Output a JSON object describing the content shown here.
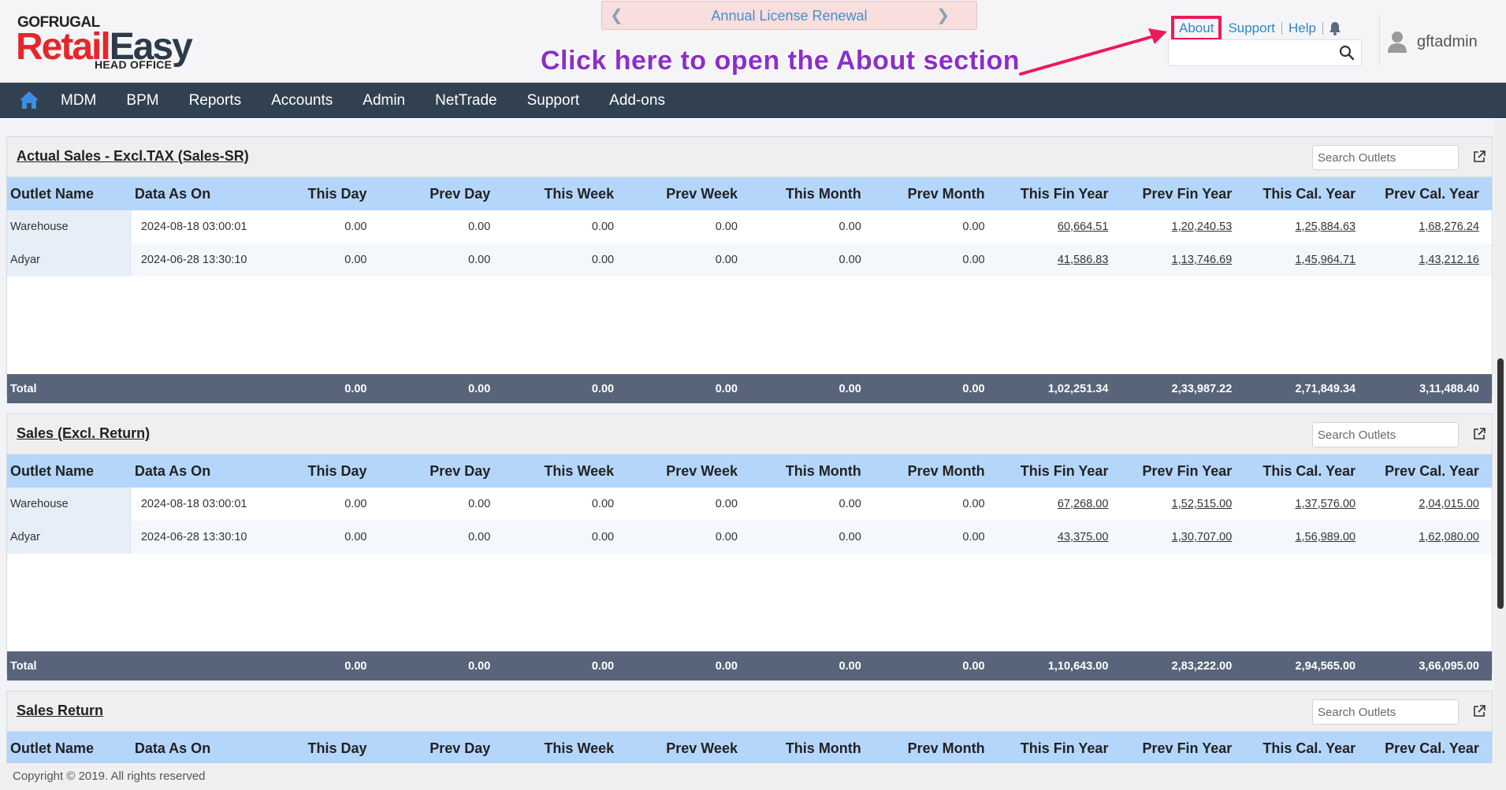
{
  "brand": {
    "top": "GOFRUGAL",
    "main_red": "Retail",
    "main_dark": "Easy",
    "sub": "HEAD OFFICE"
  },
  "renewal": {
    "label": "Annual License Renewal"
  },
  "annotation": {
    "text": "Click here to open the About section"
  },
  "toplinks": {
    "about": "About",
    "support": "Support",
    "help": "Help"
  },
  "search": {
    "placeholder": "",
    "value": ""
  },
  "user": {
    "name": "gftadmin"
  },
  "nav": {
    "items": [
      "MDM",
      "BPM",
      "Reports",
      "Accounts",
      "Admin",
      "NetTrade",
      "Support",
      "Add-ons"
    ]
  },
  "columns": [
    "Outlet Name",
    "Data As On",
    "This Day",
    "Prev Day",
    "This Week",
    "Prev Week",
    "This Month",
    "Prev Month",
    "This Fin Year",
    "Prev Fin Year",
    "This Cal. Year",
    "Prev Cal. Year"
  ],
  "outlet_search_placeholder": "Search Outlets",
  "panels": [
    {
      "title": "Actual Sales - Excl.TAX (Sales-SR)",
      "rows": [
        [
          "Warehouse",
          "2024-08-18 03:00:01",
          "0.00",
          "0.00",
          "0.00",
          "0.00",
          "0.00",
          "0.00",
          "60,664.51",
          "1,20,240.53",
          "1,25,884.63",
          "1,68,276.24"
        ],
        [
          "Adyar",
          "2024-06-28 13:30:10",
          "0.00",
          "0.00",
          "0.00",
          "0.00",
          "0.00",
          "0.00",
          "41,586.83",
          "1,13,746.69",
          "1,45,964.71",
          "1,43,212.16"
        ]
      ],
      "total": [
        "Total",
        "",
        "0.00",
        "0.00",
        "0.00",
        "0.00",
        "0.00",
        "0.00",
        "1,02,251.34",
        "2,33,987.22",
        "2,71,849.34",
        "3,11,488.40"
      ]
    },
    {
      "title": "Sales (Excl. Return)",
      "rows": [
        [
          "Warehouse",
          "2024-08-18 03:00:01",
          "0.00",
          "0.00",
          "0.00",
          "0.00",
          "0.00",
          "0.00",
          "67,268.00",
          "1,52,515.00",
          "1,37,576.00",
          "2,04,015.00"
        ],
        [
          "Adyar",
          "2024-06-28 13:30:10",
          "0.00",
          "0.00",
          "0.00",
          "0.00",
          "0.00",
          "0.00",
          "43,375.00",
          "1,30,707.00",
          "1,56,989.00",
          "1,62,080.00"
        ]
      ],
      "total": [
        "Total",
        "",
        "0.00",
        "0.00",
        "0.00",
        "0.00",
        "0.00",
        "0.00",
        "1,10,643.00",
        "2,83,222.00",
        "2,94,565.00",
        "3,66,095.00"
      ]
    },
    {
      "title": "Sales Return",
      "rows": [],
      "total": []
    }
  ],
  "footer": {
    "text": "Copyright © 2019. All rights reserved"
  },
  "colors": {
    "nav_bg": "#324152",
    "header_row": "#b5d6fb",
    "total_row": "#58647a",
    "annotation": "#8b2fc9",
    "highlight": "#ec1a5b",
    "link": "#2e86c9"
  },
  "icons": [
    "home-icon",
    "bell-icon",
    "search-icon",
    "user-icon",
    "external-link-icon",
    "chevron-left-icon",
    "chevron-right-icon"
  ]
}
